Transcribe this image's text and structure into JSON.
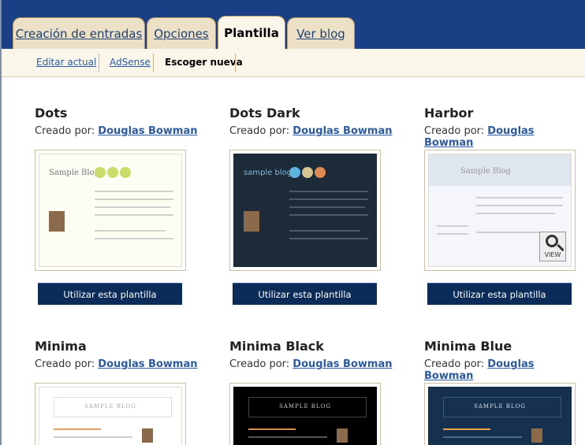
{
  "tabs": [
    {
      "label": "Creación de entradas"
    },
    {
      "label": "Opciones"
    },
    {
      "label": "Plantilla"
    },
    {
      "label": "Ver blog"
    }
  ],
  "subnav": [
    {
      "label": "Editar actual"
    },
    {
      "label": "AdSense"
    },
    {
      "label": "Escoger nueva"
    }
  ],
  "by_prefix": "Creado por:",
  "use_label": "Utilizar esta plantilla",
  "view_label": "VIEW",
  "templates": [
    {
      "name": "Dots",
      "author": "Douglas Bowman",
      "preview_heading": "Sample Blog"
    },
    {
      "name": "Dots Dark",
      "author": "Douglas Bowman",
      "preview_heading": "sample blog"
    },
    {
      "name": "Harbor",
      "author": "Douglas Bowman",
      "preview_heading": "Sample Blog"
    },
    {
      "name": "Minima",
      "author": "Douglas Bowman",
      "preview_heading": "SAMPLE BLOG"
    },
    {
      "name": "Minima Black",
      "author": "Douglas Bowman",
      "preview_heading": "SAMPLE BLOG"
    },
    {
      "name": "Minima Blue",
      "author": "Douglas Bowman",
      "preview_heading": "SAMPLE BLOG"
    }
  ],
  "colors": {
    "header": "#1b3f85",
    "tab": "#ece1c6",
    "subnav": "#faf6ea",
    "button": "#0b2b59",
    "link": "#2c5aa0"
  }
}
